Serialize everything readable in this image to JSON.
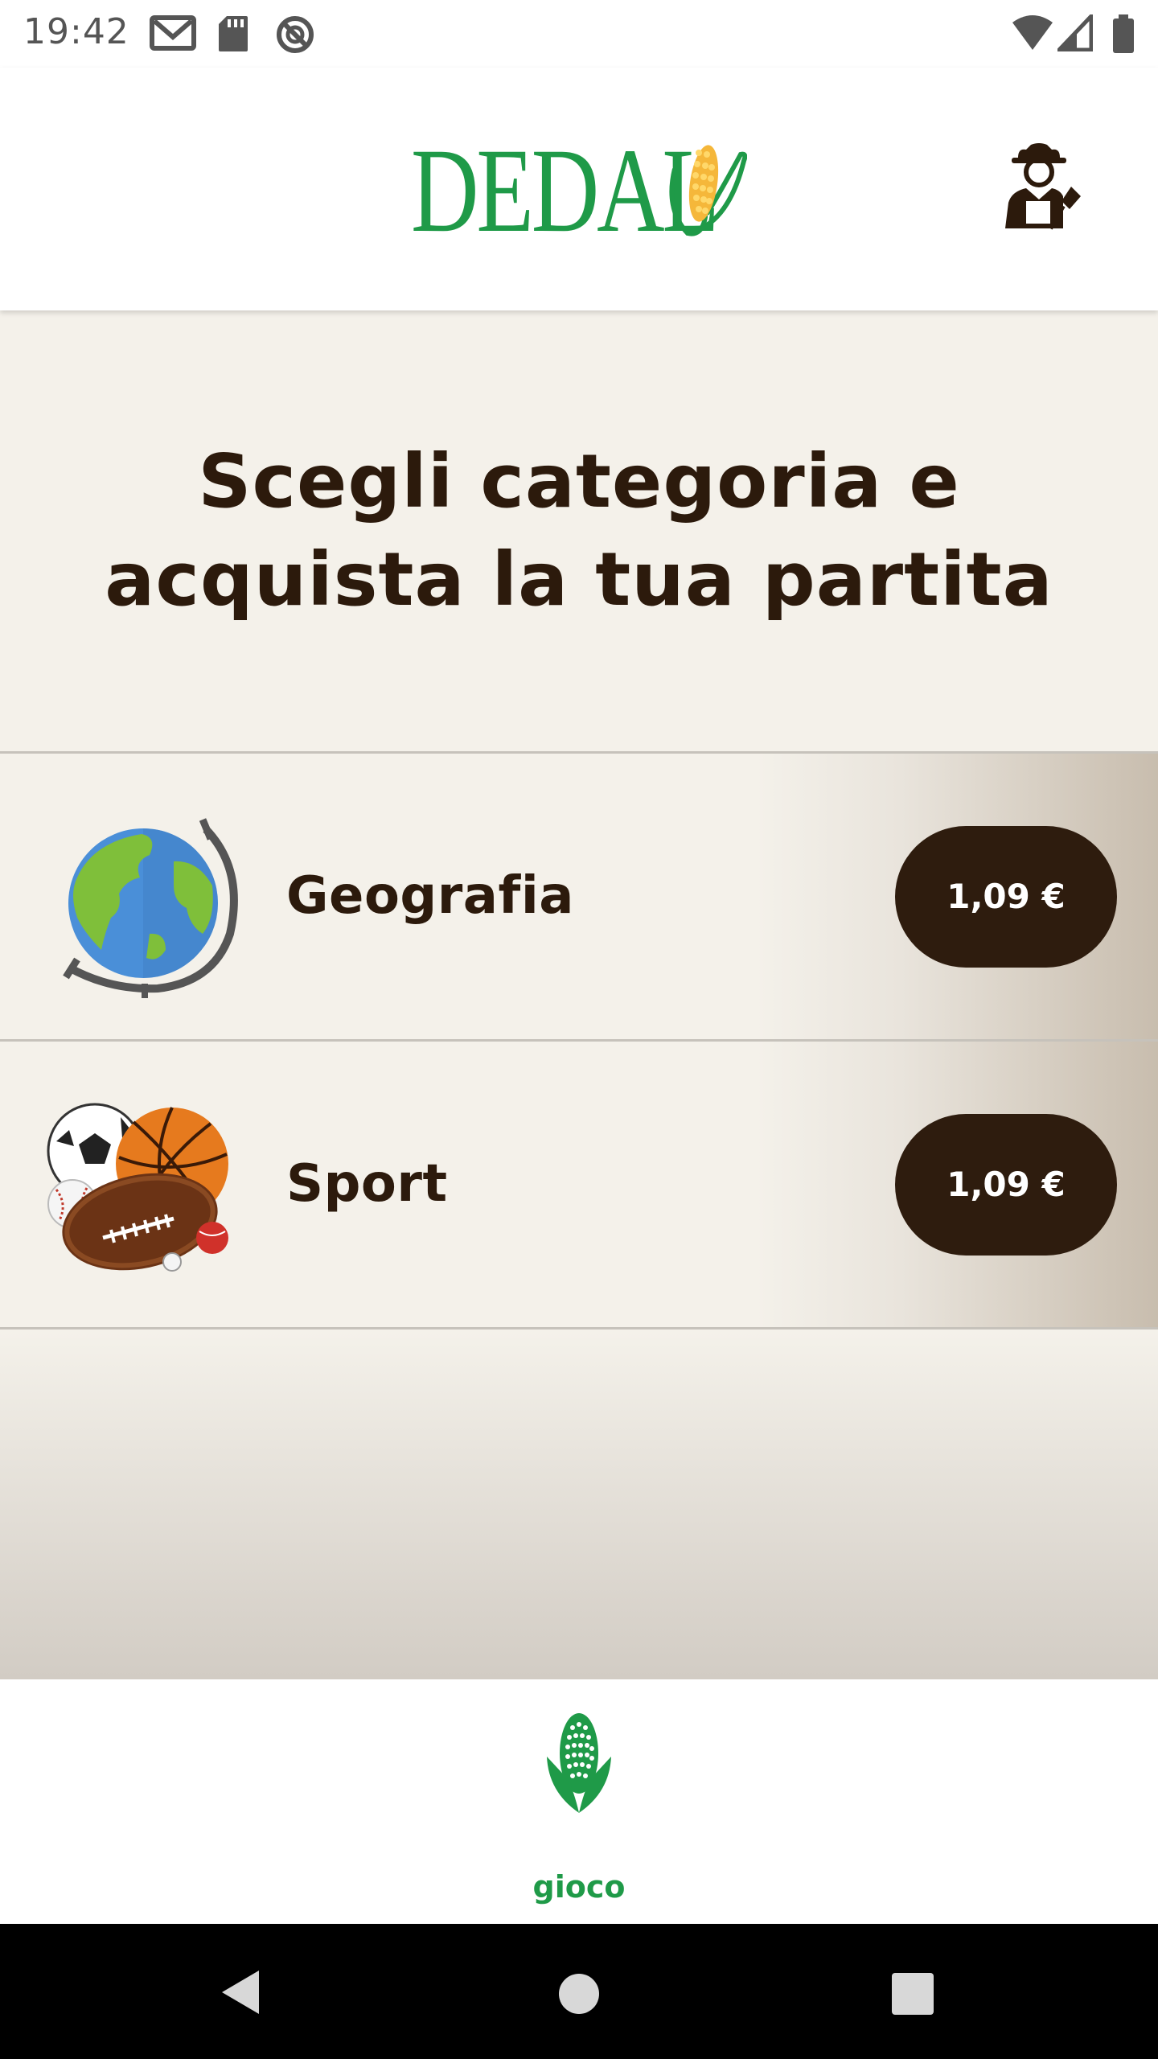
{
  "status_bar": {
    "time": "19:42",
    "icons": [
      "gmail-icon",
      "sd-card-icon",
      "no-disturb-icon",
      "wifi-icon",
      "signal-icon",
      "battery-icon"
    ]
  },
  "header": {
    "logo_text": "DEDAL",
    "brand_color": "#1f9a48",
    "profile_icon": "farmer-icon"
  },
  "main": {
    "heading_line1": "Scegli categoria e",
    "heading_line2": "acquista la tua partita",
    "categories": [
      {
        "name": "Geografia",
        "icon": "globe-icon",
        "price": "1,09 €"
      },
      {
        "name": "Sport",
        "icon": "sports-balls-icon",
        "price": "1,09 €"
      }
    ]
  },
  "bottom_nav": {
    "items": [
      {
        "label": "gioco",
        "icon": "corn-icon",
        "active": true
      }
    ]
  },
  "system_nav": [
    "back-button",
    "home-button",
    "recents-button"
  ],
  "colors": {
    "accent": "#1f9a48",
    "dark_brown": "#2e1c0e",
    "background": "#f4f1ea"
  }
}
